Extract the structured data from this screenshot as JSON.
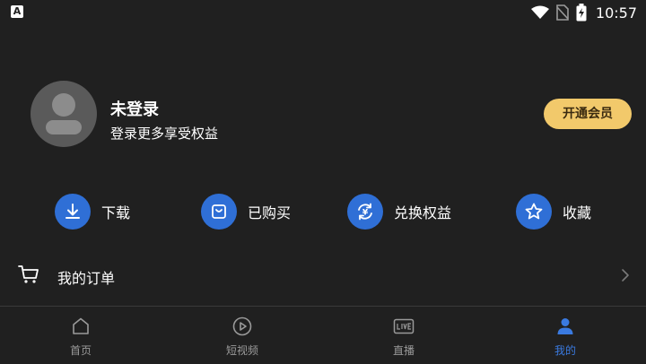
{
  "status_bar": {
    "app_badge": "A",
    "time": "10:57"
  },
  "profile": {
    "name": "未登录",
    "subtitle": "登录更多享受权益",
    "vip_button": "开通会员"
  },
  "quick_actions": [
    {
      "label": "下载",
      "icon": "download-icon"
    },
    {
      "label": "已购买",
      "icon": "bag-icon"
    },
    {
      "label": "兑换权益",
      "icon": "exchange-yuan-icon"
    },
    {
      "label": "收藏",
      "icon": "star-icon"
    }
  ],
  "orders": {
    "label": "我的订单",
    "icon": "cart-icon"
  },
  "tabs": [
    {
      "label": "首页",
      "icon": "home-icon",
      "active": false
    },
    {
      "label": "短视频",
      "icon": "play-circle-icon",
      "active": false
    },
    {
      "label": "直播",
      "icon": "live-icon",
      "active": false
    },
    {
      "label": "我的",
      "icon": "person-icon",
      "active": true
    }
  ],
  "colors": {
    "background": "#202020",
    "accent_blue": "#2f6fd6",
    "active_tab": "#3a7ae0",
    "vip_gold": "#f2c96b"
  }
}
